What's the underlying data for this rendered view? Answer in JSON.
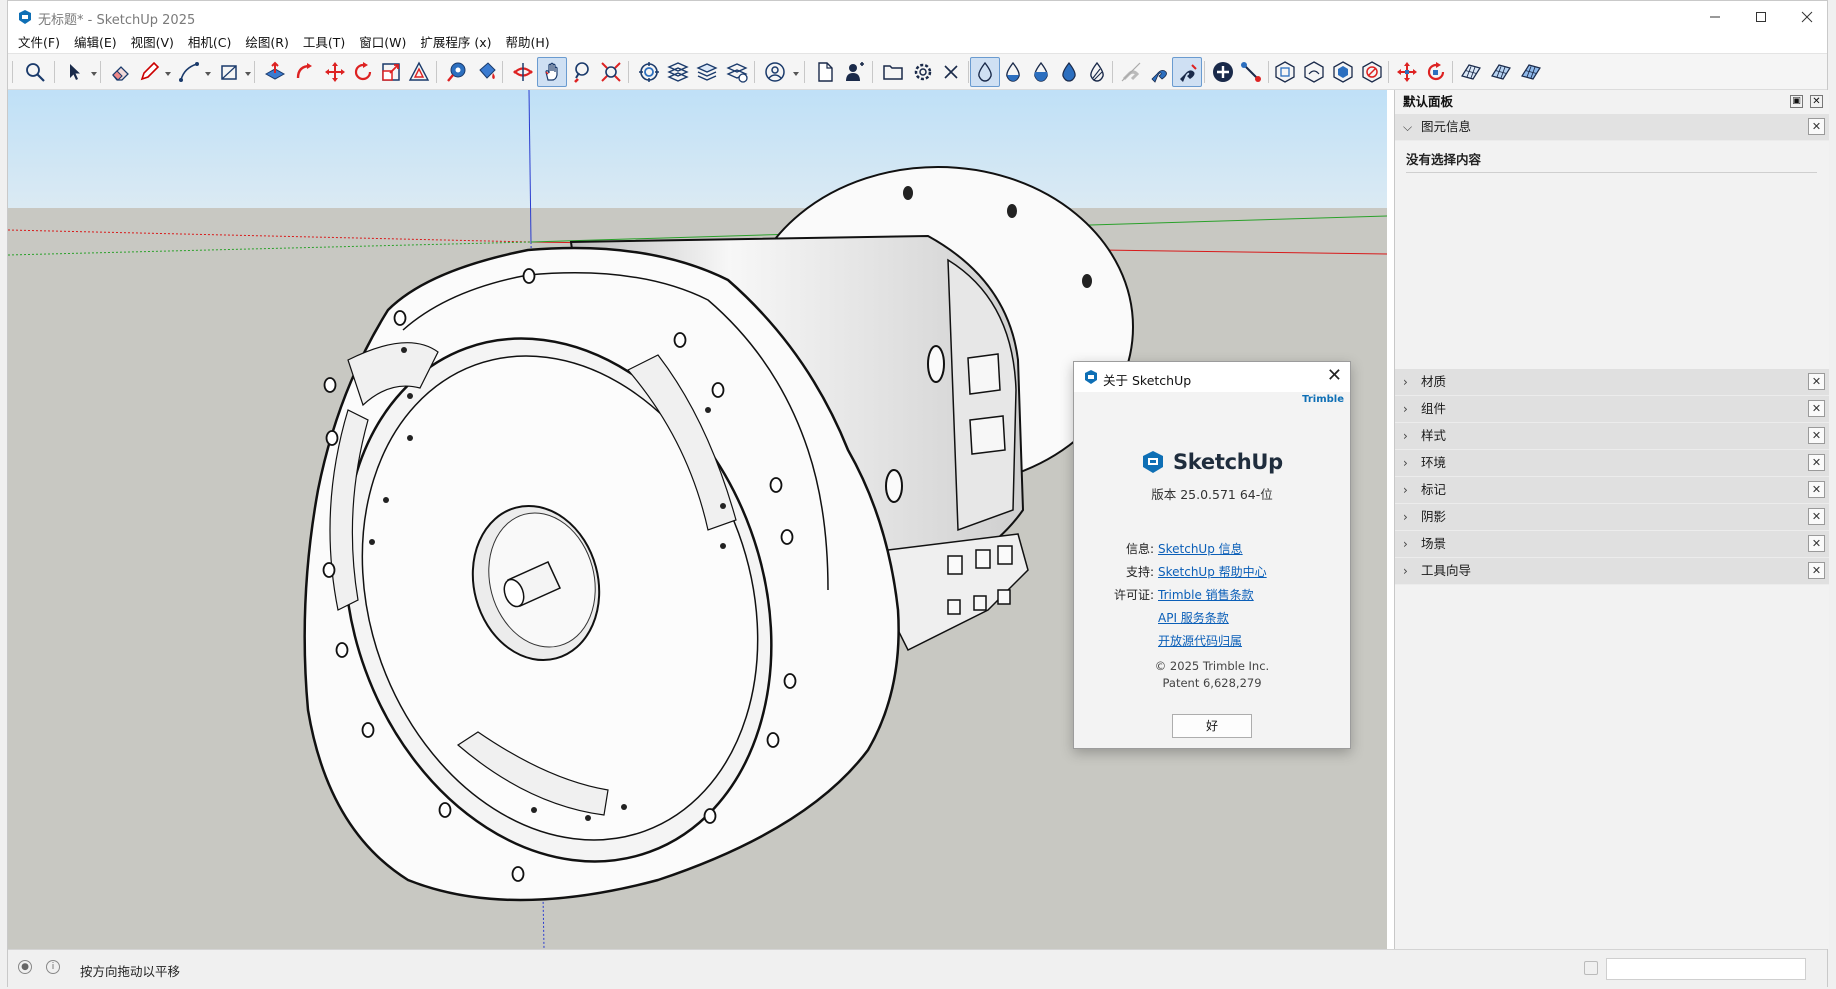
{
  "window": {
    "title": "无标题* - SketchUp 2025",
    "controls": [
      "minimize-icon",
      "maximize-icon",
      "close-icon"
    ]
  },
  "menu": [
    "文件(F)",
    "编辑(E)",
    "视图(V)",
    "相机(C)",
    "绘图(R)",
    "工具(T)",
    "窗口(W)",
    "扩展程序 (x)",
    "帮助(H)"
  ],
  "toolbar": {
    "icons": [
      "zoom-icon",
      "select-icon",
      "eraser-icon",
      "pencil-icon",
      "line-icon",
      "rectangle-icon",
      "push-pull-icon",
      "follow-me-icon",
      "move-icon",
      "rotate-icon",
      "scale-icon",
      "offset-icon",
      "tape-measure-icon",
      "paint-bucket-icon",
      "orbit-icon",
      "pan-icon",
      "zoom-window-icon",
      "zoom-extents-icon",
      "sandbox-icon",
      "layers-icon",
      "stack-icon",
      "flatten-icon",
      "account-icon",
      "new-doc-icon",
      "user-icon",
      "open-folder-icon",
      "gear-icon",
      "x-icon",
      "water-drop-icon",
      "water-drop-half-icon",
      "water-drop-solid-icon",
      "water-drop-blue-icon",
      "water-drop-stripe-icon",
      "magnet-off-icon",
      "magnet-icon",
      "magnet-active-icon",
      "add-circle-icon",
      "node-link-icon",
      "hexagon-icon",
      "hexagon-outline-icon",
      "hexagon-solid-icon",
      "hexagon-red-icon",
      "move-red-icon",
      "rotate-red-icon",
      "mesh-icon",
      "mesh-alt-icon",
      "mesh-grid-icon"
    ],
    "active": [
      "pan-icon",
      "water-drop-icon",
      "magnet-active-icon"
    ]
  },
  "panel": {
    "title": "默认面板",
    "entity_info": {
      "label": "图元信息",
      "message": "没有选择内容"
    },
    "trays": [
      "材质",
      "组件",
      "样式",
      "环境",
      "标记",
      "阴影",
      "场景",
      "工具向导"
    ]
  },
  "about": {
    "title": "关于 SketchUp",
    "brand": "Trimble",
    "product": "SketchUp",
    "version": "版本 25.0.571 64-位",
    "rows": [
      {
        "label": "信息:",
        "link": "SketchUp 信息"
      },
      {
        "label": "支持:",
        "link": "SketchUp 帮助中心"
      },
      {
        "label": "许可证:",
        "link": "Trimble 销售条款"
      },
      {
        "label": "",
        "link": "API 服务条款"
      },
      {
        "label": "",
        "link": "开放源代码归属"
      }
    ],
    "copyright": "© 2025 Trimble Inc.",
    "patent": "Patent 6,628,279",
    "ok_label": "好"
  },
  "status": {
    "text": "按方向拖动以平移",
    "icons": [
      "location-icon",
      "info-icon"
    ],
    "measurements_value": ""
  },
  "colors": {
    "sky": "#cfe6f7",
    "ground": "#c8c8c2",
    "axis_red": "#d81a1a",
    "axis_green": "#2aa12a",
    "axis_blue": "#2a3ccf",
    "link": "#0b5fb8"
  }
}
